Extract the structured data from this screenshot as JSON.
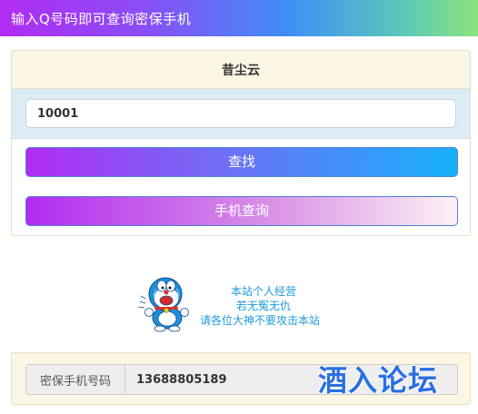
{
  "header": {
    "title": "输入Q号码即可查询密保手机"
  },
  "panel": {
    "title": "昔尘云",
    "qq_input": {
      "value": "10001",
      "placeholder": ""
    },
    "search_button": "查找",
    "phone_query_button": "手机查询"
  },
  "notice": {
    "lines": [
      "本站个人经营",
      "若无冤无仇",
      "请各位大神不要攻击本站"
    ]
  },
  "result": {
    "label": "密保手机号码",
    "value": "13688805189"
  },
  "watermark": {
    "text": "酒入论坛"
  },
  "colors": {
    "accent_purple": "#b12cf2",
    "accent_blue": "#18b1fb",
    "notice_blue": "#1e9adf"
  }
}
